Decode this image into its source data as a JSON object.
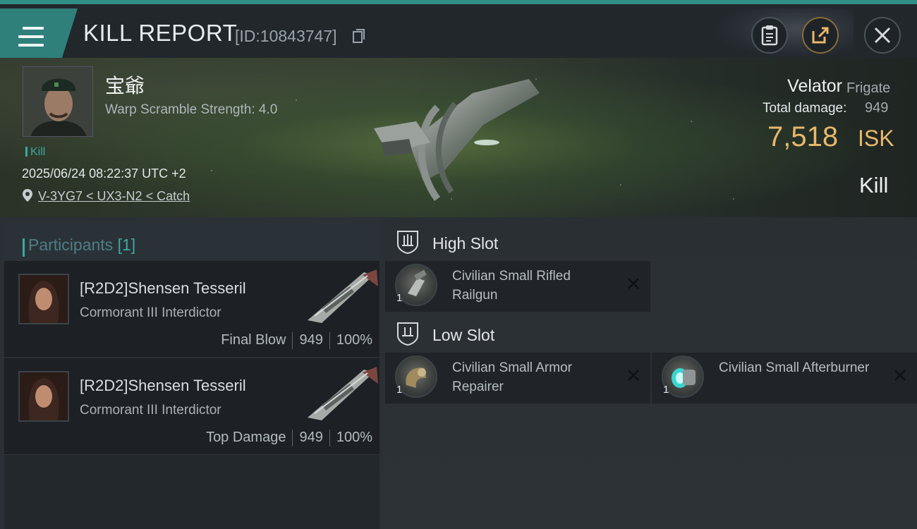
{
  "header": {
    "title": "KILL REPORT",
    "report_id": "[ID:10843747]",
    "icons": [
      "menu-icon",
      "copy-icon",
      "clipboard-icon",
      "share-icon",
      "close-icon"
    ]
  },
  "victim": {
    "name": "宝爺",
    "warp_scramble": "Warp Scramble Strength: 4.0",
    "tag": "Kill",
    "timestamp": "2025/06/24 08:22:37 UTC +2",
    "location": "V-3YG7 < UX3-N2 < Catch"
  },
  "ship": {
    "name": "Velator",
    "class": "Frigate",
    "damage_label": "Total damage:",
    "damage_value": "949",
    "isk_value": "7,518",
    "isk_unit": "ISK",
    "result": "Kill"
  },
  "participants": {
    "title": "Participants",
    "count": "[1]",
    "rows": [
      {
        "name": "[R2D2]Shensen Tesseril",
        "ship": "Cormorant III Interdictor",
        "role": "Final Blow",
        "damage": "949",
        "percent": "100%"
      },
      {
        "name": "[R2D2]Shensen Tesseril",
        "ship": "Cormorant III Interdictor",
        "role": "Top Damage",
        "damage": "949",
        "percent": "100%"
      }
    ]
  },
  "fitting": {
    "high_slot": {
      "title": "High Slot",
      "items": [
        {
          "name": "Civilian Small Rifled Railgun",
          "qty": "1"
        }
      ]
    },
    "low_slot": {
      "title": "Low Slot",
      "items": [
        {
          "name": "Civilian Small Armor Repairer",
          "qty": "1"
        },
        {
          "name": "Civilian Small Afterburner",
          "qty": "1"
        }
      ]
    }
  },
  "colors": {
    "accent": "#3aa9a0",
    "isk": "#e8b86a",
    "background": "#1b1f23"
  }
}
